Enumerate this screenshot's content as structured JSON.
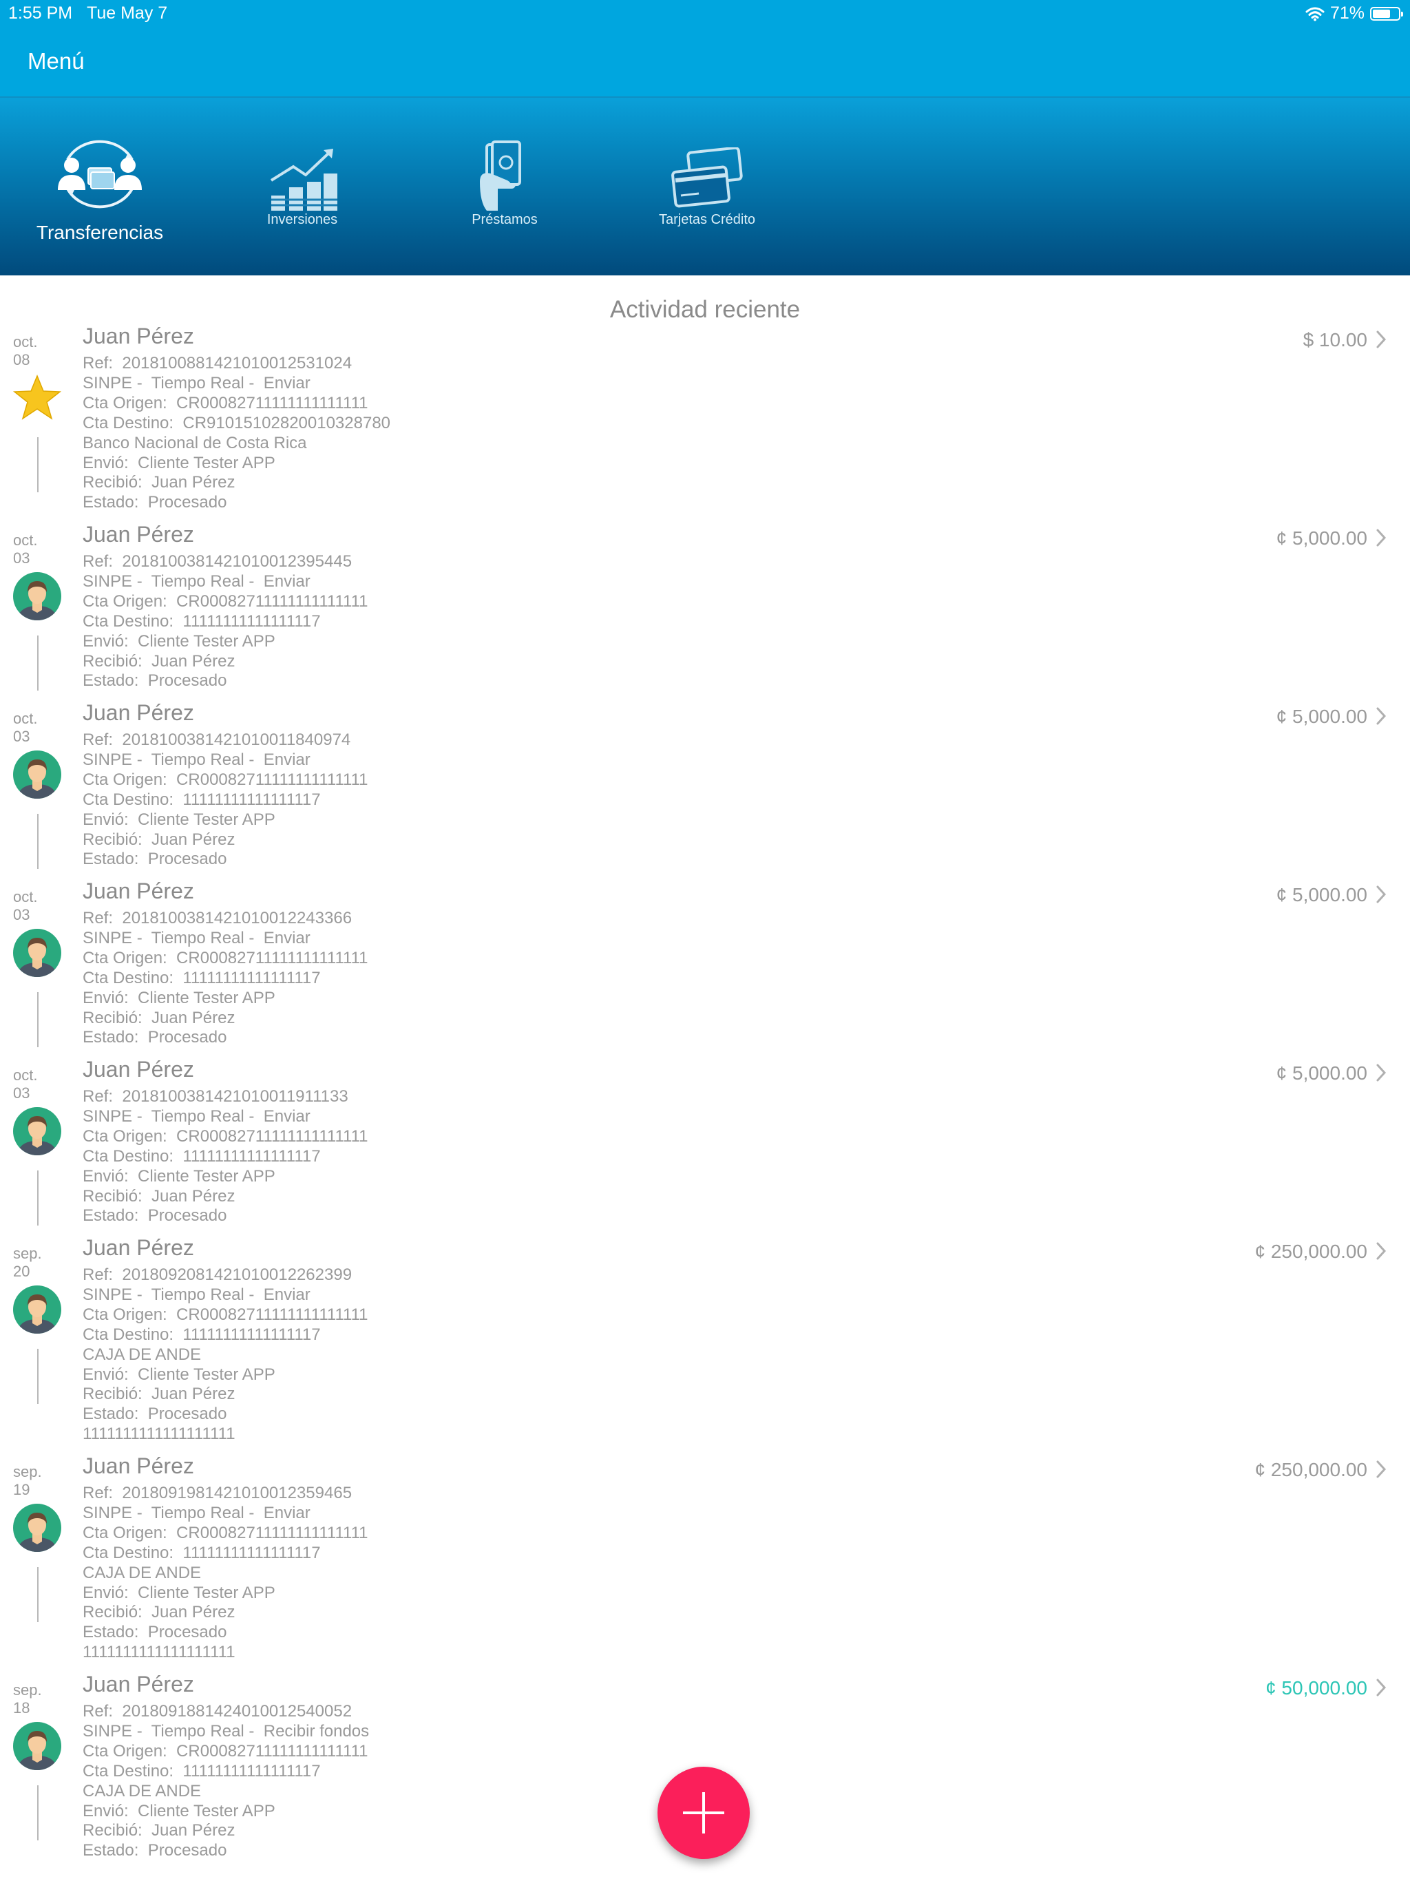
{
  "status_bar": {
    "time": "1:55 PM",
    "date": "Tue May 7",
    "battery": "71%"
  },
  "nav": {
    "menu_label": "Menú"
  },
  "categories": [
    {
      "label": "Transferencias",
      "icon": "transfer-icon",
      "active": true
    },
    {
      "label": "Inversiones",
      "icon": "investments-icon",
      "active": false
    },
    {
      "label": "Préstamos",
      "icon": "loans-icon",
      "active": false
    },
    {
      "label": "Tarjetas Crédito",
      "icon": "credit-cards-icon",
      "active": false
    }
  ],
  "section_title": "Actividad reciente",
  "colors": {
    "header_blue": "#00a6df",
    "fab_red": "#fb1f5a",
    "positive_amount": "#2cc5b5"
  },
  "activities": [
    {
      "month": "oct.",
      "day": "08",
      "avatar": "star-icon",
      "name": "Juan Pérez",
      "amount": "$ 10.00",
      "positive": false,
      "lines": [
        "Ref:  2018100881421010012531024",
        "SINPE -  Tiempo Real -  Enviar",
        "Cta Origen:  CR00082711111111111111",
        "Cta Destino:  CR91015102820010328780",
        "Banco Nacional de Costa Rica",
        "Envió:  Cliente Tester APP",
        "Recibió:  Juan Pérez",
        "Estado:  Procesado"
      ]
    },
    {
      "month": "oct.",
      "day": "03",
      "avatar": "person-avatar-icon",
      "name": "Juan Pérez",
      "amount": "¢ 5,000.00",
      "positive": false,
      "lines": [
        "Ref:  2018100381421010012395445",
        "SINPE -  Tiempo Real -  Enviar",
        "Cta Origen:  CR00082711111111111111",
        "Cta Destino:  11111111111111117",
        "Envió:  Cliente Tester APP",
        "Recibió:  Juan Pérez",
        "Estado:  Procesado"
      ]
    },
    {
      "month": "oct.",
      "day": "03",
      "avatar": "person-avatar-icon",
      "name": "Juan Pérez",
      "amount": "¢ 5,000.00",
      "positive": false,
      "lines": [
        "Ref:  2018100381421010011840974",
        "SINPE -  Tiempo Real -  Enviar",
        "Cta Origen:  CR00082711111111111111",
        "Cta Destino:  11111111111111117",
        "Envió:  Cliente Tester APP",
        "Recibió:  Juan Pérez",
        "Estado:  Procesado"
      ]
    },
    {
      "month": "oct.",
      "day": "03",
      "avatar": "person-avatar-icon",
      "name": "Juan Pérez",
      "amount": "¢ 5,000.00",
      "positive": false,
      "lines": [
        "Ref:  2018100381421010012243366",
        "SINPE -  Tiempo Real -  Enviar",
        "Cta Origen:  CR00082711111111111111",
        "Cta Destino:  11111111111111117",
        "Envió:  Cliente Tester APP",
        "Recibió:  Juan Pérez",
        "Estado:  Procesado"
      ]
    },
    {
      "month": "oct.",
      "day": "03",
      "avatar": "person-avatar-icon",
      "name": "Juan Pérez",
      "amount": "¢ 5,000.00",
      "positive": false,
      "lines": [
        "Ref:  2018100381421010011911133",
        "SINPE -  Tiempo Real -  Enviar",
        "Cta Origen:  CR00082711111111111111",
        "Cta Destino:  11111111111111117",
        "Envió:  Cliente Tester APP",
        "Recibió:  Juan Pérez",
        "Estado:  Procesado"
      ]
    },
    {
      "month": "sep.",
      "day": "20",
      "avatar": "person-avatar-icon",
      "name": "Juan Pérez",
      "amount": "¢ 250,000.00",
      "positive": false,
      "lines": [
        "Ref:  2018092081421010012262399",
        "SINPE -  Tiempo Real -  Enviar",
        "Cta Origen:  CR00082711111111111111",
        "Cta Destino:  11111111111111117",
        "CAJA DE ANDE",
        "Envió:  Cliente Tester APP",
        "Recibió:  Juan Pérez",
        "Estado:  Procesado",
        "1111111111111111111"
      ]
    },
    {
      "month": "sep.",
      "day": "19",
      "avatar": "person-avatar-icon",
      "name": "Juan Pérez",
      "amount": "¢ 250,000.00",
      "positive": false,
      "lines": [
        "Ref:  2018091981421010012359465",
        "SINPE -  Tiempo Real -  Enviar",
        "Cta Origen:  CR00082711111111111111",
        "Cta Destino:  11111111111111117",
        "CAJA DE ANDE",
        "Envió:  Cliente Tester APP",
        "Recibió:  Juan Pérez",
        "Estado:  Procesado",
        "1111111111111111111"
      ]
    },
    {
      "month": "sep.",
      "day": "18",
      "avatar": "person-avatar-icon",
      "name": "Juan Pérez",
      "amount": "¢ 50,000.00",
      "positive": true,
      "lines": [
        "Ref:  2018091881424010012540052",
        "SINPE -  Tiempo Real -  Recibir fondos",
        "Cta Origen:  CR00082711111111111111",
        "Cta Destino:  11111111111111117",
        "CAJA DE ANDE",
        "Envió:  Cliente Tester APP",
        "Recibió:  Juan Pérez",
        "Estado:  Procesado"
      ]
    }
  ]
}
